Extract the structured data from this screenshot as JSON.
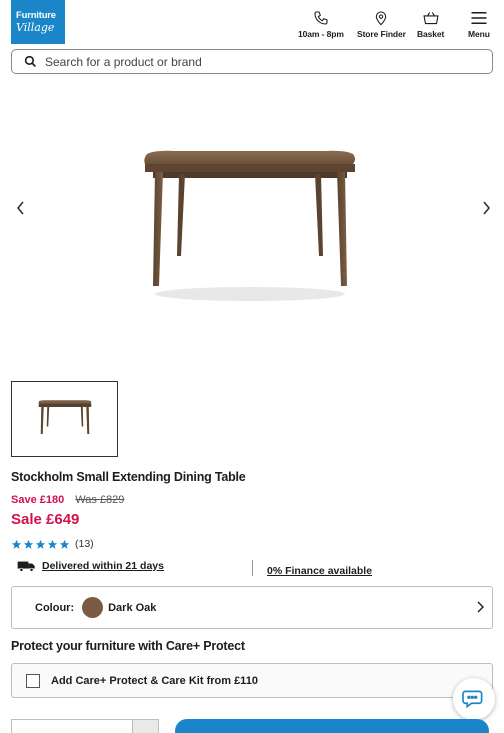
{
  "brand": {
    "line1": "Furniture",
    "line2": "Village",
    "color": "#1a86c9"
  },
  "header": {
    "hours_label": "10am - 8pm",
    "store_finder_label": "Store Finder",
    "basket_label": "Basket",
    "menu_label": "Menu"
  },
  "search": {
    "placeholder": "Search for a product or brand"
  },
  "product": {
    "title": "Stockholm Small Extending Dining Table",
    "save": "Save £180",
    "was": "Was £829",
    "price": "Sale £649",
    "rating_stars": 5,
    "rating_count": "(13)",
    "delivery": "Delivered within 21 days",
    "finance": "0% Finance available",
    "colour_label": "Colour:",
    "colour_name": "Dark Oak",
    "colour_swatch": "#7b5a43",
    "sale_color": "#d0134d"
  },
  "care": {
    "heading": "Protect your furniture with Care+ Protect",
    "option_label": "Add Care+ Protect & Care Kit from £110"
  },
  "icons": {
    "phone": "phone-icon",
    "store": "map-pin-icon",
    "basket": "basket-icon",
    "menu": "hamburger-icon",
    "search": "search-icon",
    "prev": "chevron-left-icon",
    "next": "chevron-right-icon",
    "star": "star-icon",
    "truck": "truck-icon",
    "chat": "chat-icon"
  }
}
